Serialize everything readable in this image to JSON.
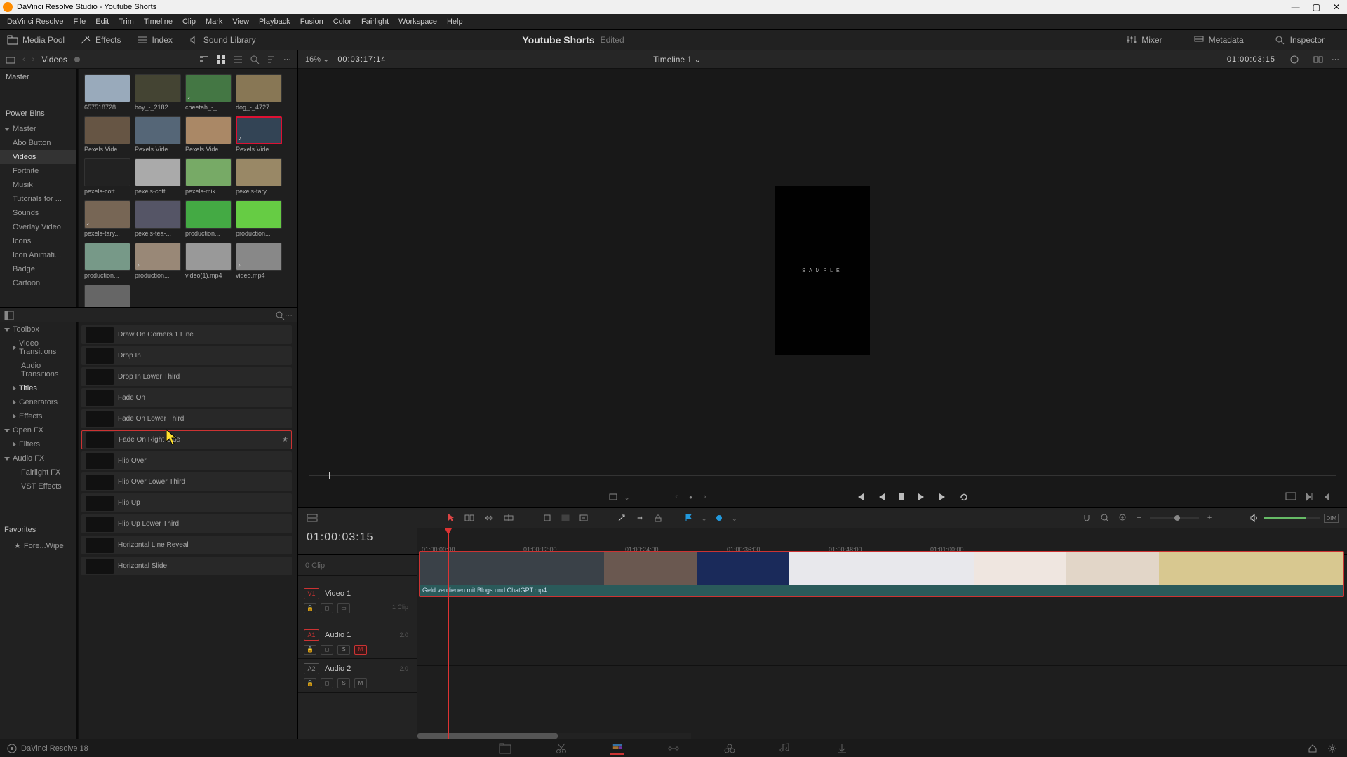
{
  "window_title": "DaVinci Resolve Studio - Youtube Shorts",
  "menu": [
    "DaVinci Resolve",
    "File",
    "Edit",
    "Trim",
    "Timeline",
    "Clip",
    "Mark",
    "View",
    "Playback",
    "Fusion",
    "Color",
    "Fairlight",
    "Workspace",
    "Help"
  ],
  "toolbar": {
    "media_pool": "Media Pool",
    "effects": "Effects",
    "index": "Index",
    "sound_library": "Sound Library",
    "mixer": "Mixer",
    "metadata": "Metadata",
    "inspector": "Inspector",
    "project": "Youtube Shorts",
    "edited": "Edited"
  },
  "pool": {
    "crumb": "Videos",
    "master": "Master",
    "power_bins": "Power Bins",
    "items": [
      "Abo Button",
      "Videos",
      "Fortnite",
      "Musik",
      "Tutorials for ...",
      "Sounds",
      "Overlay Video",
      "Icons",
      "Icon Animati...",
      "Badge",
      "Cartoon"
    ],
    "clips": [
      "657518728...",
      "boy_-_2182...",
      "cheetah_-_...",
      "dog_-_4727...",
      "Pexels Vide...",
      "Pexels Vide...",
      "Pexels Vide...",
      "Pexels Vide...",
      "pexels-cott...",
      "pexels-cott...",
      "pexels-mik...",
      "pexels-tary...",
      "pexels-tary...",
      "pexels-tea-...",
      "production...",
      "production...",
      "production...",
      "production...",
      "video(1).mp4",
      "video.mp4",
      ""
    ],
    "selected_clip_index": 7
  },
  "fx": {
    "cats_hdr": "Toolbox",
    "cats": [
      "Video Transitions",
      "Audio Transitions",
      "Titles",
      "Generators",
      "Effects"
    ],
    "openfx": "Open FX",
    "filters": "Filters",
    "audiofx": "Audio FX",
    "audiocats": [
      "Fairlight FX",
      "VST Effects"
    ],
    "favorites": "Favorites",
    "fav_item": "Fore...Wipe",
    "list": [
      "Draw On Corners 1 Line",
      "Drop In",
      "Drop In Lower Third",
      "Fade On",
      "Fade On Lower Third",
      "Fade On Right Side",
      "Flip Over",
      "Flip Over Lower Third",
      "Flip Up",
      "Flip Up Lower Third",
      "Horizontal Line Reveal",
      "Horizontal Slide"
    ],
    "selected_index": 5
  },
  "viewer": {
    "zoom": "16%",
    "tc_src": "00:03:17:14",
    "timeline_name": "Timeline 1",
    "tc_rec": "01:00:03:15",
    "sample": "SAMPLE"
  },
  "timeline": {
    "big_tc": "01:00:03:15",
    "ticks": [
      "01:00:00:00",
      "01:00:12:00",
      "01:00:24:00",
      "01:00:36:00",
      "01:00:48:00",
      "01:01:00:00"
    ],
    "sub_label": "0 Clip",
    "v1_badge": "V1",
    "v1_name": "Video 1",
    "v1_count": "1 Clip",
    "a1_badge": "A1",
    "a1_name": "Audio 1",
    "a1_level": "2.0",
    "a2_badge": "A2",
    "a2_name": "Audio 2",
    "a2_level": "2.0",
    "clip_label": "Geld verdienen mit Blogs und ChatGPT.mp4"
  },
  "footer": {
    "app": "DaVinci Resolve 18"
  }
}
